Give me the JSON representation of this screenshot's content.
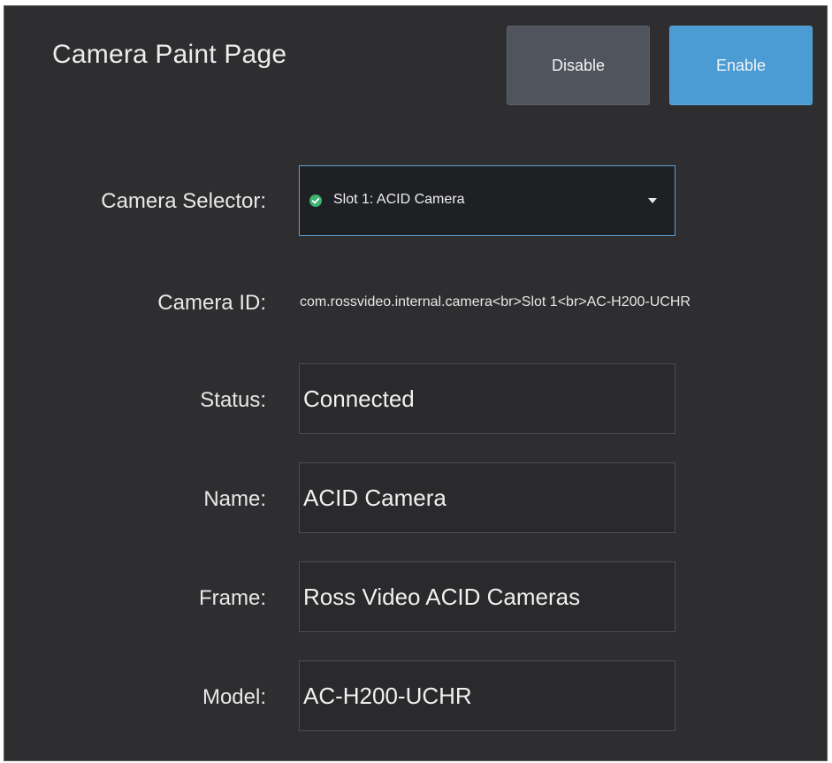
{
  "page": {
    "title": "Camera Paint Page"
  },
  "buttons": {
    "disable_label": "Disable",
    "enable_label": "Enable"
  },
  "camera_selector": {
    "label": "Camera Selector:",
    "selected_value": "Slot 1: ACID Camera",
    "status_icon": "check-circle-icon",
    "status_color": "#3cb371"
  },
  "camera_id": {
    "label": "Camera ID:",
    "value": "com.rossvideo.internal.camera<br>Slot 1<br>AC-H200-UCHR"
  },
  "fields": {
    "status": {
      "label": "Status:",
      "value": "Connected"
    },
    "name": {
      "label": "Name:",
      "value": "ACID Camera"
    },
    "frame": {
      "label": "Frame:",
      "value": "Ross Video ACID Cameras"
    },
    "model": {
      "label": "Model:",
      "value": "AC-H200-UCHR"
    }
  },
  "colors": {
    "background": "#2e2e30",
    "enable_accent": "#4b9bd4",
    "disable_button": "#50545d",
    "select_border": "#5fa1d6"
  }
}
